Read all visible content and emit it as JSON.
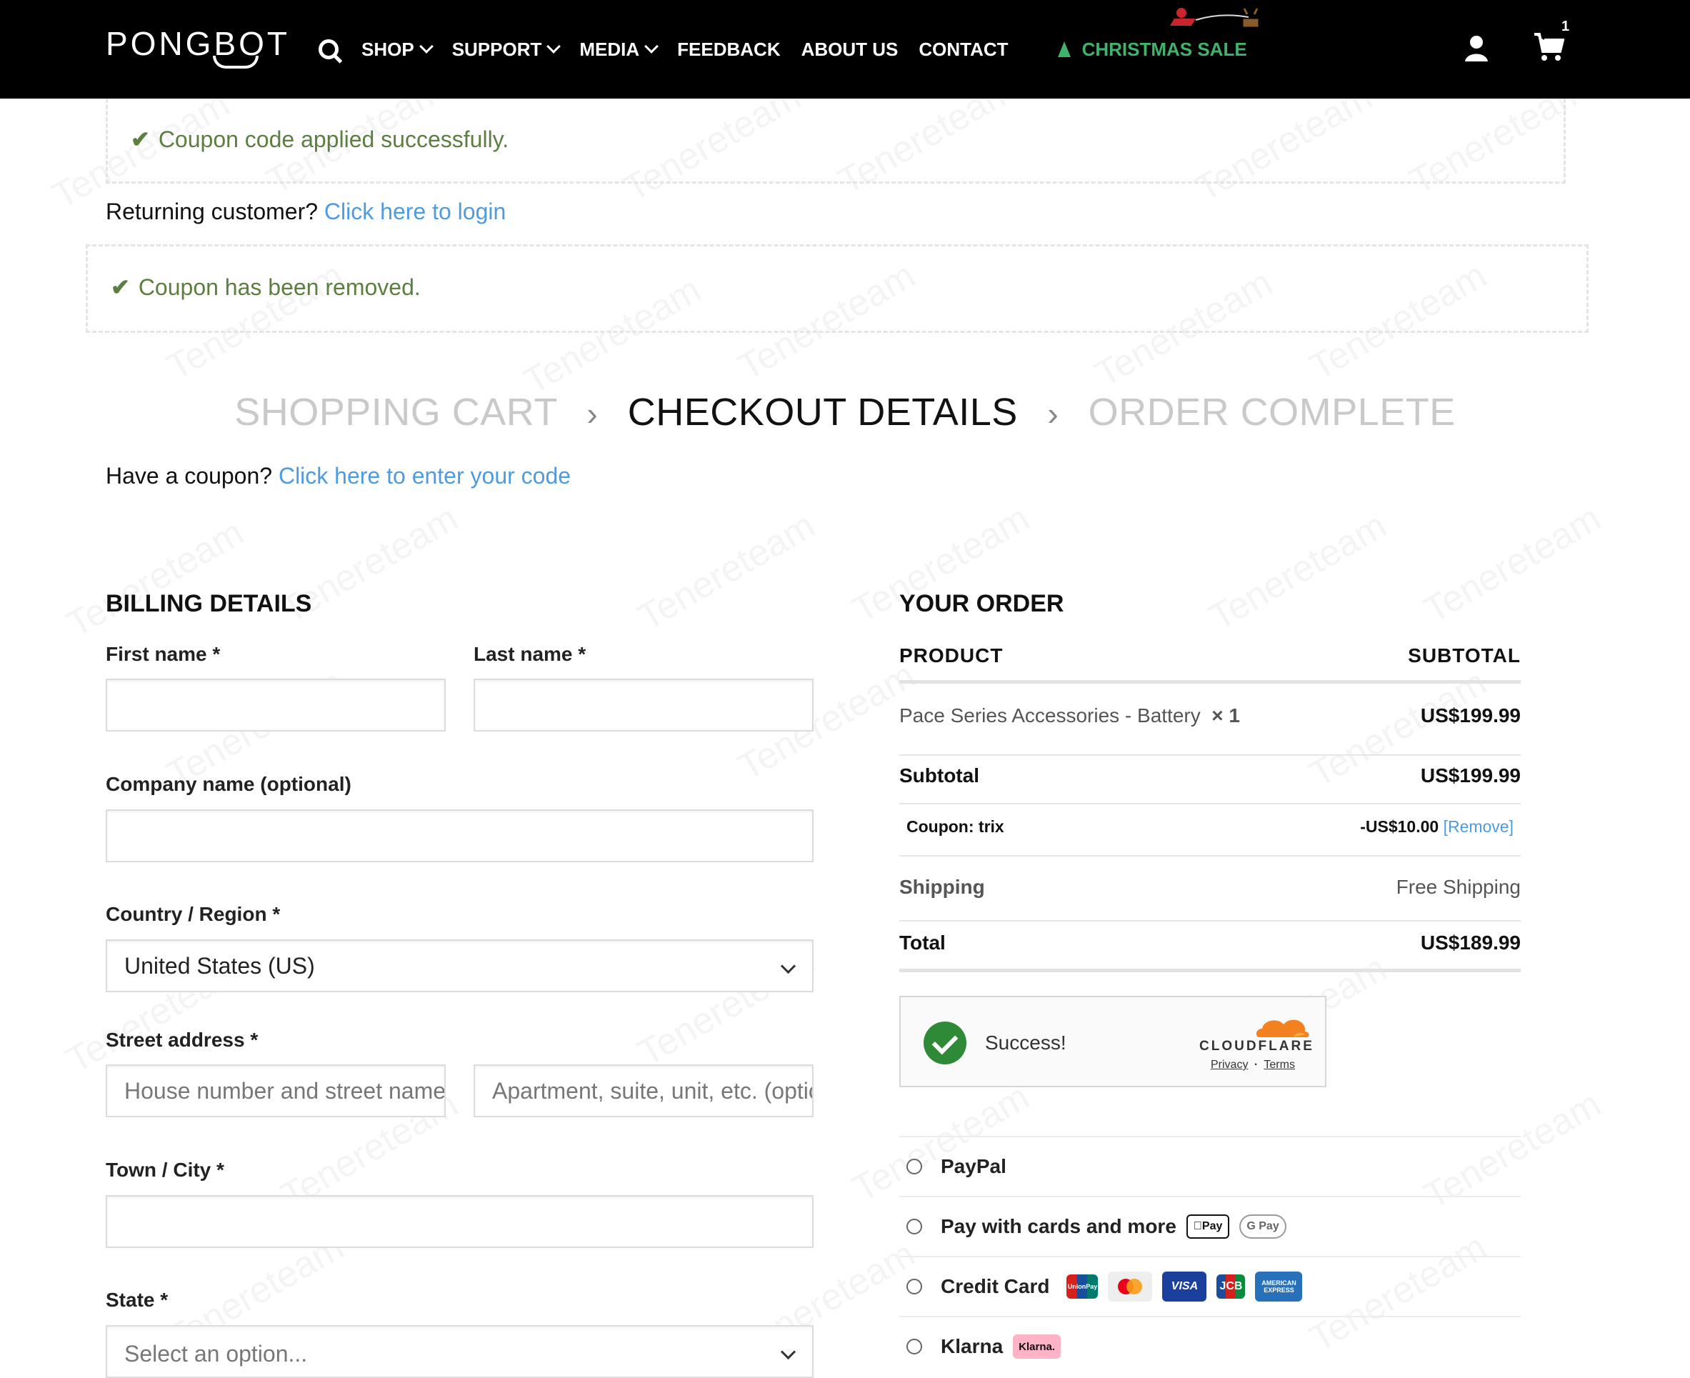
{
  "header": {
    "logo": "PONGBOT",
    "nav": [
      {
        "label": "SHOP",
        "dropdown": true
      },
      {
        "label": "SUPPORT",
        "dropdown": true
      },
      {
        "label": "MEDIA",
        "dropdown": true
      },
      {
        "label": "FEEDBACK",
        "dropdown": false
      },
      {
        "label": "ABOUT US",
        "dropdown": false
      },
      {
        "label": "CONTACT",
        "dropdown": false
      }
    ],
    "sale_label": "CHRISTMAS SALE",
    "cart_count": "1"
  },
  "notices": {
    "coupon_applied": "Coupon code applied successfully.",
    "coupon_removed": "Coupon has been removed.",
    "returning_text": "Returning customer?",
    "login_link": "Click here to login"
  },
  "steps": {
    "cart": "SHOPPING CART",
    "checkout": "CHECKOUT DETAILS",
    "complete": "ORDER COMPLETE"
  },
  "coupon": {
    "question": "Have a coupon?",
    "link": "Click here to enter your code"
  },
  "billing": {
    "title": "BILLING DETAILS",
    "first_name_label": "First name *",
    "last_name_label": "Last name *",
    "company_label": "Company name (optional)",
    "country_label": "Country / Region *",
    "country_value": "United States (US)",
    "street_label": "Street address *",
    "street_placeholder": "House number and street name",
    "apt_placeholder": "Apartment, suite, unit, etc. (optional)",
    "city_label": "Town / City *",
    "state_label": "State *",
    "state_placeholder": "Select an option..."
  },
  "order": {
    "title": "YOUR ORDER",
    "col_product": "PRODUCT",
    "col_subtotal": "SUBTOTAL",
    "item_name": "Pace Series Accessories - Battery",
    "item_qty": "× 1",
    "item_price": "US$199.99",
    "subtotal_label": "Subtotal",
    "subtotal_value": "US$199.99",
    "coupon_label": "Coupon: trix",
    "coupon_value": "-US$10.00",
    "coupon_remove": "[Remove]",
    "shipping_label": "Shipping",
    "shipping_value": "Free Shipping",
    "total_label": "Total",
    "total_value": "US$189.99"
  },
  "captcha": {
    "status": "Success!",
    "brand": "CLOUDFLARE",
    "privacy": "Privacy",
    "dot": "·",
    "terms": "Terms"
  },
  "payment": {
    "paypal": "PayPal",
    "cards_more": "Pay with cards and more",
    "apple_pay": "Pay",
    "google_pay": "G Pay",
    "credit_card": "Credit Card",
    "unionpay": "UnionPay",
    "visa": "VISA",
    "jcb": "JCB",
    "amex": "AMERICAN EXPRESS",
    "klarna": "Klarna",
    "klarna_badge": "Klarna."
  },
  "colors": {
    "success_green": "#5c7f41",
    "link_blue": "#4e9be0",
    "sale_green": "#3fb36b"
  }
}
